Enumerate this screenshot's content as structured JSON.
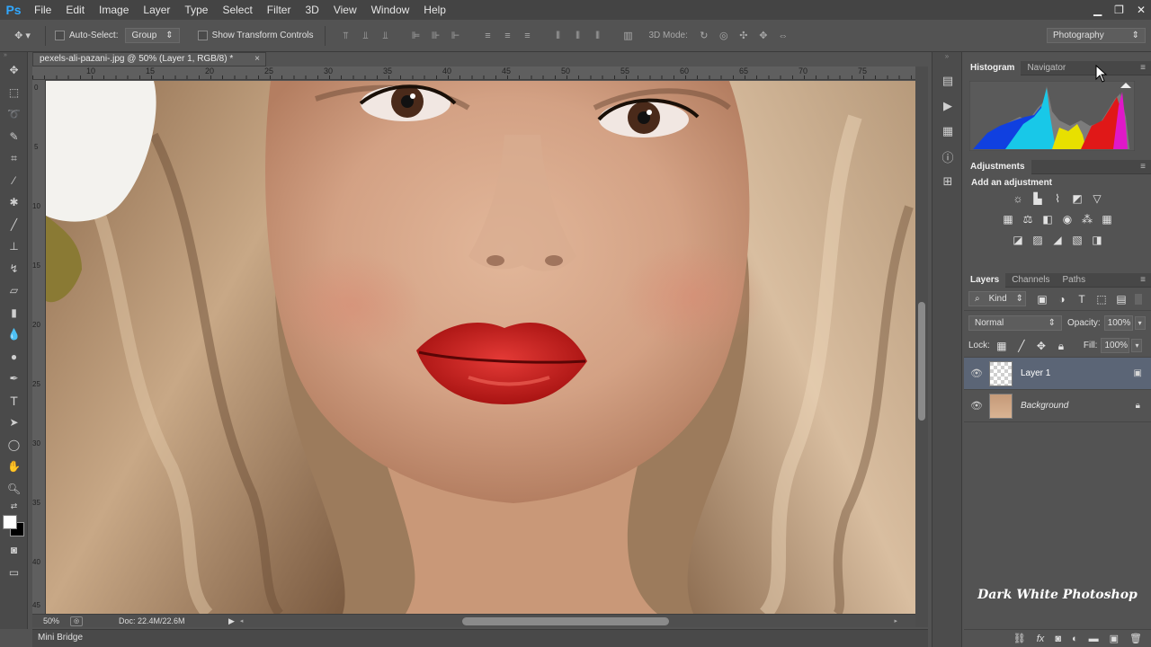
{
  "app": {
    "logo": "Ps"
  },
  "menu": [
    "File",
    "Edit",
    "Image",
    "Layer",
    "Type",
    "Select",
    "Filter",
    "3D",
    "View",
    "Window",
    "Help"
  ],
  "window_controls": [
    "minimize-icon",
    "restore-icon",
    "close-icon"
  ],
  "options": {
    "auto_select_label": "Auto-Select:",
    "auto_select_value": "Group",
    "show_transform_label": "Show Transform Controls",
    "mode_3d_label": "3D Mode:",
    "workspace": "Photography"
  },
  "document": {
    "tab_title": "pexels-ali-pazani-.jpg @ 50% (Layer 1, RGB/8) *",
    "ruler_top": [
      "10",
      "15",
      "20",
      "25",
      "30",
      "35",
      "40",
      "45",
      "50",
      "55",
      "60",
      "65",
      "70",
      "75"
    ],
    "ruler_left": [
      "0",
      "5",
      "10",
      "15",
      "20",
      "25",
      "30",
      "35",
      "40",
      "45"
    ],
    "zoom": "50%",
    "doc_size": "Doc: 22.4M/22.6M"
  },
  "mini_bridge": "Mini Bridge",
  "panels": {
    "histogram_tabs": [
      "Histogram",
      "Navigator"
    ],
    "adjustments_tab": "Adjustments",
    "adjustments_title": "Add an adjustment",
    "layers_tabs": [
      "Layers",
      "Channels",
      "Paths"
    ],
    "kind": "Kind",
    "blend_mode": "Normal",
    "opacity_label": "Opacity:",
    "opacity_value": "100%",
    "lock_label": "Lock:",
    "fill_label": "Fill:",
    "fill_value": "100%",
    "layers": [
      {
        "name": "Layer 1",
        "selected": true
      },
      {
        "name": "Background",
        "selected": false
      }
    ]
  },
  "watermark": "Dark White Photoshop"
}
